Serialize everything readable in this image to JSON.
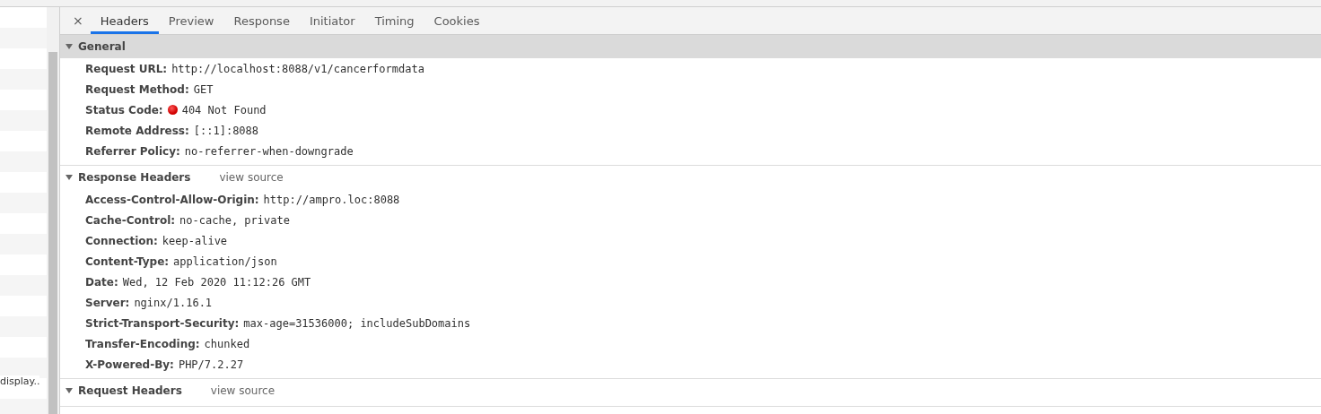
{
  "request_list": {
    "visible_name": "display.."
  },
  "tabs": [
    {
      "label": "Headers",
      "selected": true
    },
    {
      "label": "Preview",
      "selected": false
    },
    {
      "label": "Response",
      "selected": false
    },
    {
      "label": "Initiator",
      "selected": false
    },
    {
      "label": "Timing",
      "selected": false
    },
    {
      "label": "Cookies",
      "selected": false
    }
  ],
  "close_label": "×",
  "sections": [
    {
      "title": "General",
      "expanded": true,
      "shaded": true,
      "rows": [
        {
          "name": "Request URL:",
          "value": "http://localhost:8088/v1/cancerformdata",
          "kind": "plain"
        },
        {
          "name": "Request Method:",
          "value": "GET",
          "kind": "plain"
        },
        {
          "name": "Status Code:",
          "value": "404 Not Found",
          "kind": "status"
        },
        {
          "name": "Remote Address:",
          "value": "[::1]:8088",
          "kind": "plain"
        },
        {
          "name": "Referrer Policy:",
          "value": "no-referrer-when-downgrade",
          "kind": "plain"
        }
      ]
    },
    {
      "title": "Response Headers",
      "link": "view source",
      "expanded": true,
      "shaded": false,
      "rows": [
        {
          "name": "Access-Control-Allow-Origin:",
          "value": "http://ampro.loc:8088",
          "kind": "plain"
        },
        {
          "name": "Cache-Control:",
          "value": "no-cache, private",
          "kind": "plain"
        },
        {
          "name": "Connection:",
          "value": "keep-alive",
          "kind": "plain"
        },
        {
          "name": "Content-Type:",
          "value": "application/json",
          "kind": "plain"
        },
        {
          "name": "Date:",
          "value": "Wed, 12 Feb 2020 11:12:26 GMT",
          "kind": "plain"
        },
        {
          "name": "Server:",
          "value": "nginx/1.16.1",
          "kind": "plain"
        },
        {
          "name": "Strict-Transport-Security:",
          "value": "max-age=31536000; includeSubDomains",
          "kind": "plain"
        },
        {
          "name": "Transfer-Encoding:",
          "value": "chunked",
          "kind": "plain"
        },
        {
          "name": "X-Powered-By:",
          "value": "PHP/7.2.27",
          "kind": "plain"
        }
      ]
    },
    {
      "title": "Request Headers",
      "link": "view source",
      "expanded": true,
      "shaded": false
    }
  ]
}
